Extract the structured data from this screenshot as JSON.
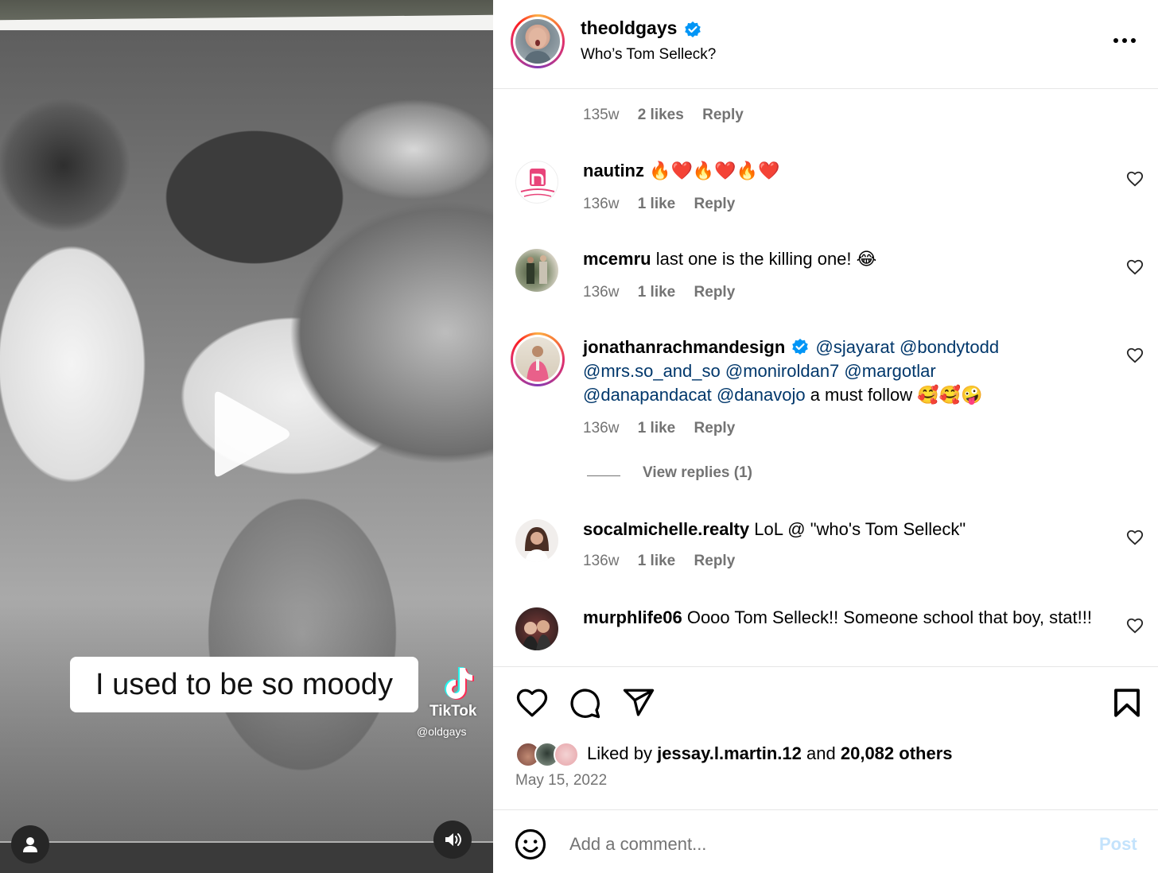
{
  "media": {
    "caption": "I used to be so moody",
    "watermark_name": "TikTok",
    "watermark_handle": "@oldgays",
    "play_icon": "play-icon",
    "audio_icon": "speaker-icon",
    "tag_icon": "user-icon"
  },
  "header": {
    "username": "theoldgays",
    "verified": true,
    "title": "Who’s Tom Selleck?",
    "more_icon": "more-icon"
  },
  "comments": {
    "partial_meta": {
      "age": "135w",
      "likes": "2 likes",
      "reply": "Reply"
    },
    "items": [
      {
        "username": "nautinz",
        "text": "🔥❤️🔥❤️🔥❤️",
        "age": "136w",
        "likes": "1 like",
        "reply": "Reply"
      },
      {
        "username": "mcemru",
        "text": "last one is the killing one! 😂",
        "age": "136w",
        "likes": "1 like",
        "reply": "Reply"
      },
      {
        "username": "jonathanrachmandesign",
        "verified": true,
        "mentions": [
          "@sjayarat",
          "@bondytodd",
          "@mrs.so_and_so",
          "@moniroldan7",
          "@margotlar",
          "@danapandacat",
          "@danavojo"
        ],
        "text_tail": "a must follow 🥰🥰🤪",
        "age": "136w",
        "likes": "1 like",
        "reply": "Reply",
        "view_replies": "View replies (1)"
      },
      {
        "username": "socalmichelle.realty",
        "text": "LoL @ \"who's Tom Selleck\"",
        "age": "136w",
        "likes": "1 like",
        "reply": "Reply"
      },
      {
        "username": "murphlife06",
        "text": "Oooo Tom Selleck!! Someone school that boy, stat!!!"
      }
    ]
  },
  "actions": {
    "icons": [
      "heart-icon",
      "comment-icon",
      "share-icon",
      "bookmark-icon"
    ],
    "liked_prefix": "Liked by",
    "liked_user": "jessay.l.martin.12",
    "liked_and": "and",
    "liked_others": "20,082 others",
    "date": "May 15, 2022"
  },
  "composer": {
    "placeholder": "Add a comment...",
    "post_label": "Post",
    "post_color": "#c4e3fc"
  },
  "colors": {
    "text_secondary": "#737373",
    "mention": "#00376b",
    "verified": "#0095f6",
    "divider": "#e6e6e6"
  }
}
